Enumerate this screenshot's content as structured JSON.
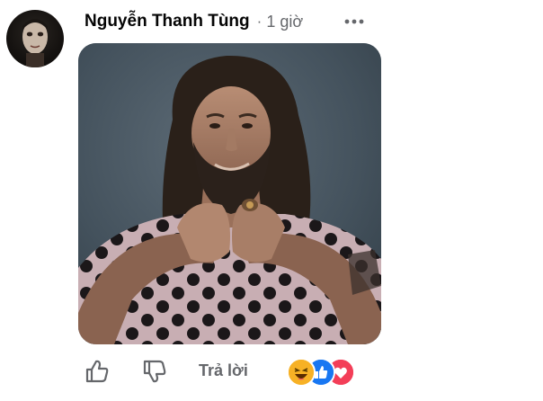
{
  "comment": {
    "author": "Nguyễn Thanh Tùng",
    "separator": "·",
    "timestamp": "1 giờ",
    "actions": {
      "reply_label": "Trả lời"
    },
    "reactions": [
      "haha",
      "like",
      "love"
    ]
  },
  "colors": {
    "secondary_text": "#65676b",
    "like_blue": "#1877f2",
    "love_red": "#f33e58",
    "haha_yellow": "#f7b125"
  }
}
